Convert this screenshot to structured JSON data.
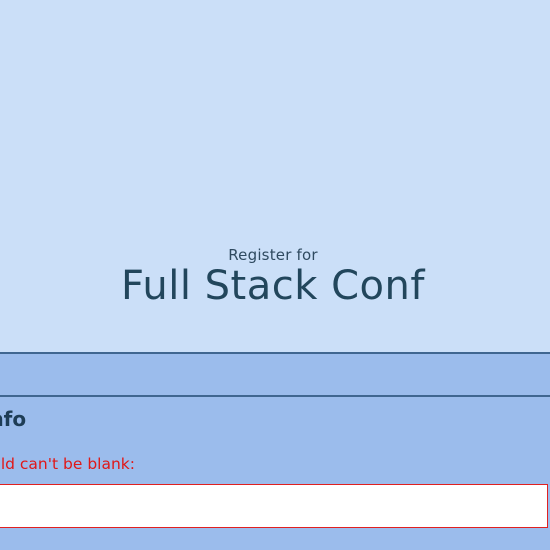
{
  "hero": {
    "pretitle": "Register for",
    "title": "Full Stack Conf"
  },
  "form": {
    "section_title": "Info",
    "error_message": "ield can't be blank:",
    "input_value": ""
  },
  "colors": {
    "hero_background": "#cbdff8",
    "section_background": "#9bbcec",
    "divider": "#3f6690",
    "heading_text": "#22465c",
    "error": "#e01818"
  }
}
